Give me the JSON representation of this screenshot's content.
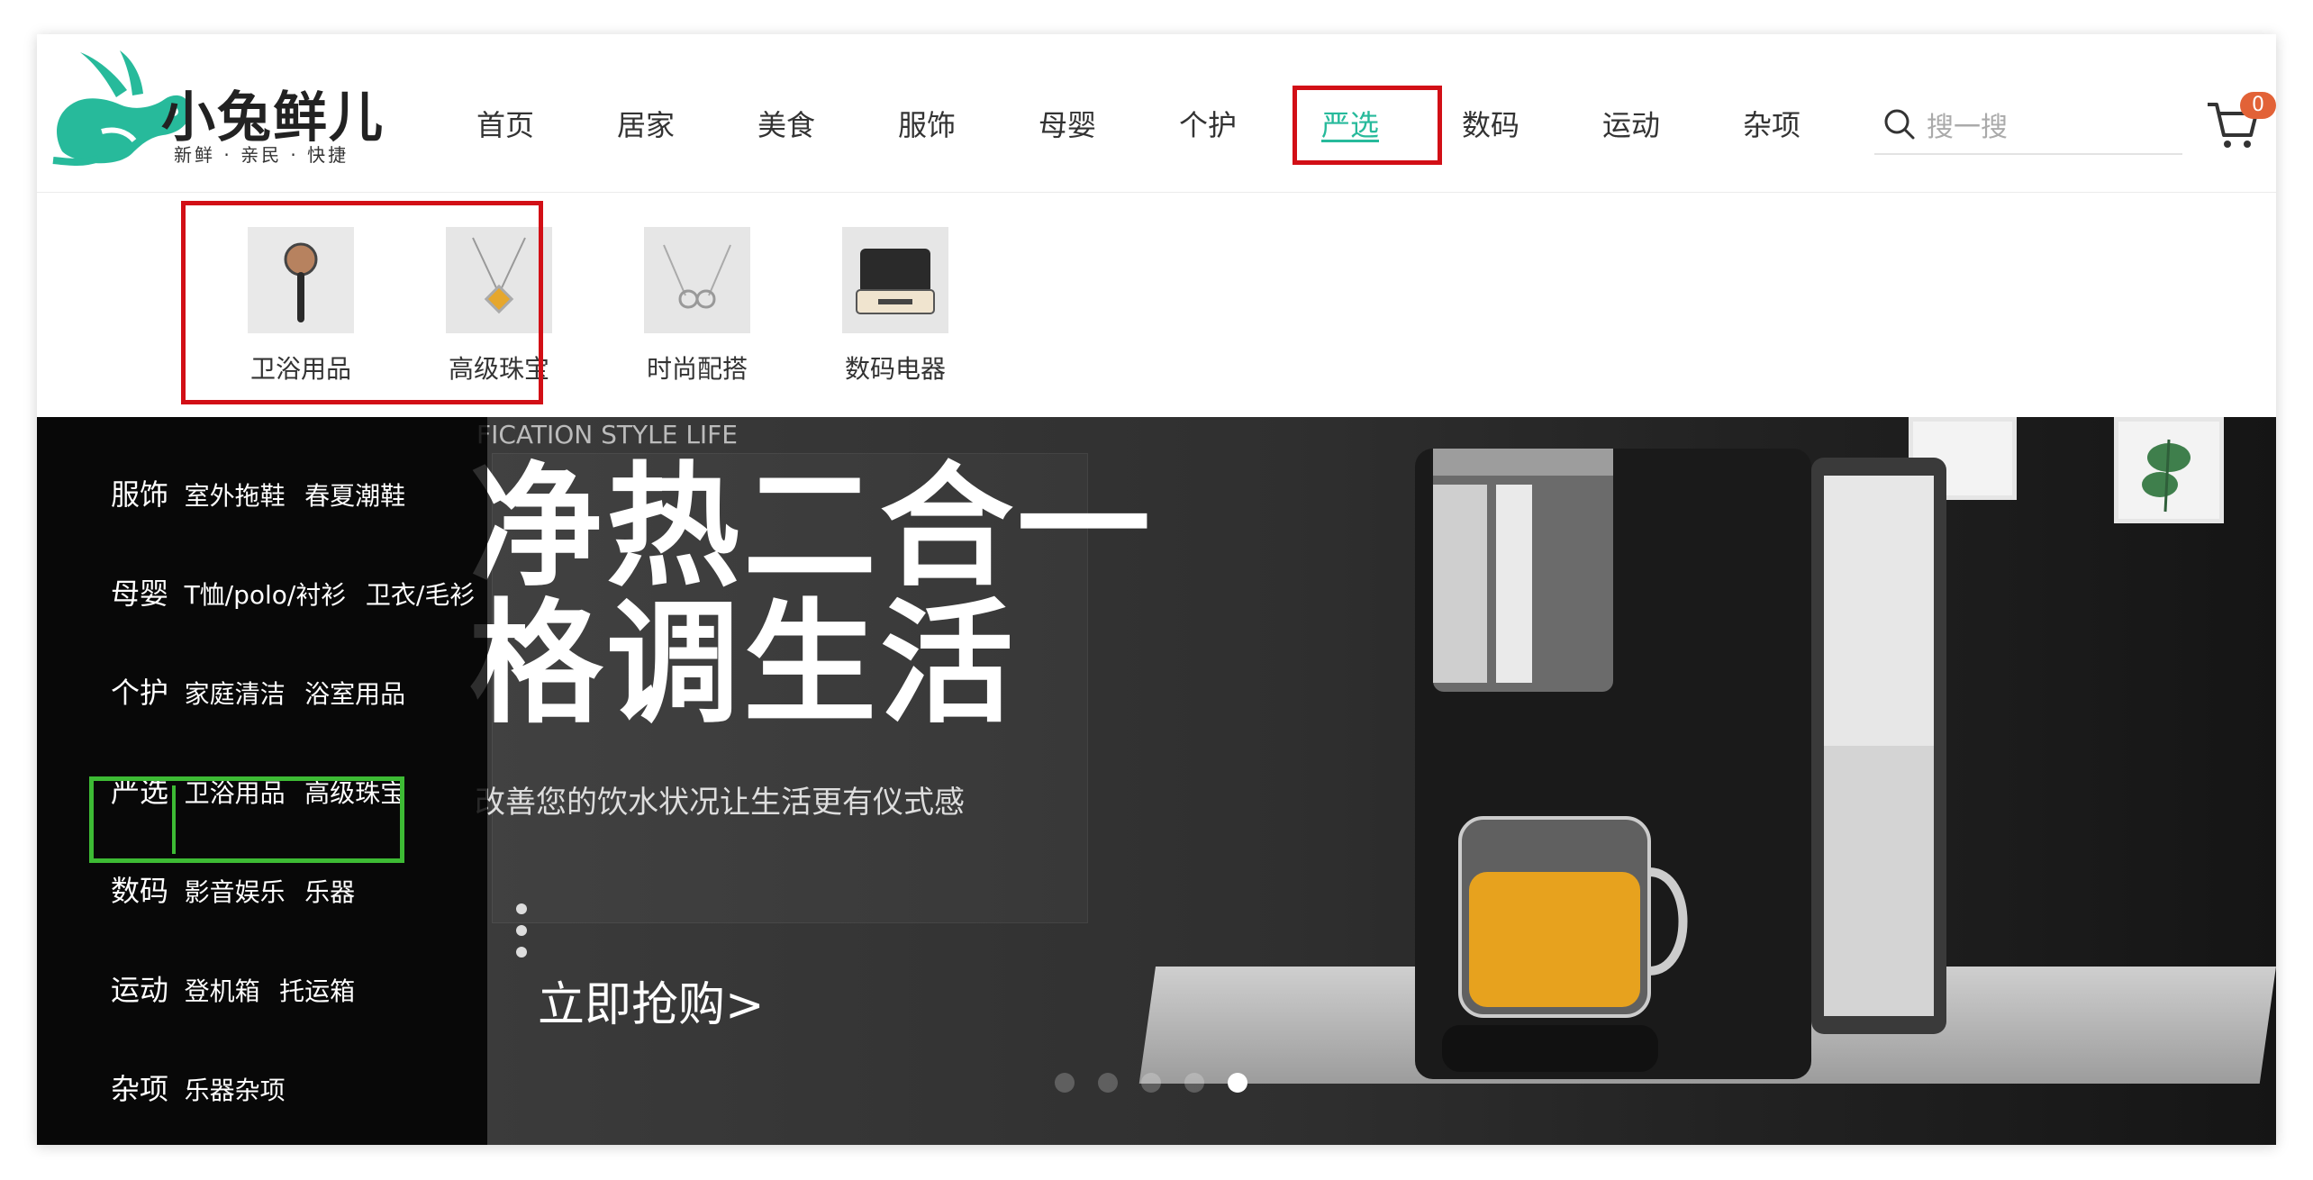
{
  "logo": {
    "name": "小兔鲜儿",
    "slogan": "新鲜 · 亲民 · 快捷",
    "color": "#27ba9b"
  },
  "nav": {
    "items": [
      {
        "label": "首页"
      },
      {
        "label": "居家"
      },
      {
        "label": "美食"
      },
      {
        "label": "服饰"
      },
      {
        "label": "母婴"
      },
      {
        "label": "个护"
      },
      {
        "label": "严选",
        "active": true
      },
      {
        "label": "数码"
      },
      {
        "label": "运动"
      },
      {
        "label": "杂项"
      }
    ]
  },
  "search": {
    "placeholder": "搜一搜",
    "icon": "search-icon"
  },
  "cart": {
    "icon": "cart-icon",
    "count": "0"
  },
  "dropdown": {
    "items": [
      {
        "label": "卫浴用品",
        "icon": "bath-product-thumbnail"
      },
      {
        "label": "高级珠宝",
        "icon": "jewelry-thumbnail"
      },
      {
        "label": "时尚配搭",
        "icon": "fashion-accessory-thumbnail"
      },
      {
        "label": "数码电器",
        "icon": "digital-appliance-thumbnail"
      }
    ]
  },
  "sidebar": {
    "categories": [
      {
        "name": "服饰",
        "subs": [
          "室外拖鞋",
          "春夏潮鞋"
        ]
      },
      {
        "name": "母婴",
        "subs": [
          "T恤/polo/衬衫",
          "卫衣/毛衫"
        ]
      },
      {
        "name": "个护",
        "subs": [
          "家庭清洁",
          "浴室用品"
        ]
      },
      {
        "name": "严选",
        "subs": [
          "卫浴用品",
          "高级珠宝"
        ]
      },
      {
        "name": "数码",
        "subs": [
          "影音娱乐",
          "乐器"
        ]
      },
      {
        "name": "运动",
        "subs": [
          "登机箱",
          "托运箱"
        ]
      },
      {
        "name": "杂项",
        "subs": [
          "乐器杂项"
        ]
      }
    ]
  },
  "banner": {
    "subtitle": "FICATION STYLE LIFE",
    "headline_line1": "净热二合一",
    "headline_line2": "格调生活",
    "description": "改善您的饮水状况让生活更有仪式感",
    "cta": "立即抢购>",
    "slide_count": 5,
    "active_slide": 5
  },
  "colors": {
    "accent": "#27ba9b",
    "highlight_red": "#d20f16",
    "highlight_green": "#3dbb34",
    "badge": "#e26237"
  }
}
